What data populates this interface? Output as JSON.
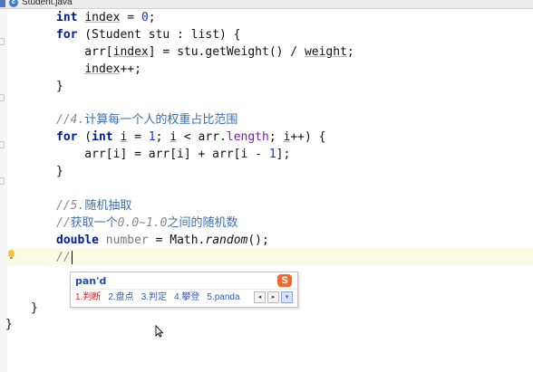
{
  "tab": {
    "label": "Student.java",
    "icon": "java-class-icon"
  },
  "code": [
    [
      {
        "t": "int",
        "c": "kw"
      },
      {
        "t": " "
      },
      {
        "t": "index",
        "c": "ul"
      },
      {
        "t": " = "
      },
      {
        "t": "0",
        "c": "num"
      },
      {
        "t": ";"
      }
    ],
    [
      {
        "t": "for",
        "c": "kw"
      },
      {
        "t": " (Student stu : list) {"
      }
    ],
    [
      {
        "t": "    arr["
      },
      {
        "t": "index",
        "c": "ul"
      },
      {
        "t": "] = stu.getWeight() / "
      },
      {
        "t": "weight",
        "c": "ul"
      },
      {
        "t": ";"
      }
    ],
    [
      {
        "t": "    "
      },
      {
        "t": "index",
        "c": "ul"
      },
      {
        "t": "++;"
      }
    ],
    [
      {
        "t": "}"
      }
    ],
    [],
    [
      {
        "t": "//4.",
        "c": "cm"
      },
      {
        "t": "计算每一个人的权重占比范围",
        "c": "cm cmj"
      }
    ],
    [
      {
        "t": "for",
        "c": "kw"
      },
      {
        "t": " ("
      },
      {
        "t": "int",
        "c": "kw"
      },
      {
        "t": " "
      },
      {
        "t": "i",
        "c": "ul"
      },
      {
        "t": " = "
      },
      {
        "t": "1",
        "c": "num"
      },
      {
        "t": "; "
      },
      {
        "t": "i",
        "c": "ul"
      },
      {
        "t": " < arr."
      },
      {
        "t": "length",
        "c": "fld"
      },
      {
        "t": "; "
      },
      {
        "t": "i",
        "c": "ul"
      },
      {
        "t": "++) {"
      }
    ],
    [
      {
        "t": "    arr[i] = arr[i] + arr[i - "
      },
      {
        "t": "1",
        "c": "num"
      },
      {
        "t": "];"
      }
    ],
    [
      {
        "t": "}"
      }
    ],
    [],
    [
      {
        "t": "//5.",
        "c": "cm"
      },
      {
        "t": "随机抽取",
        "c": "cm cmj"
      }
    ],
    [
      {
        "t": "//",
        "c": "cm"
      },
      {
        "t": "获取一个",
        "c": "cm cmj"
      },
      {
        "t": "0.0~1.0",
        "c": "cm"
      },
      {
        "t": "之间的随机数",
        "c": "cm cmj"
      }
    ],
    [
      {
        "t": "double",
        "c": "kw"
      },
      {
        "t": " "
      },
      {
        "t": "number",
        "c": "gray"
      },
      {
        "t": " = Math."
      },
      {
        "t": "random",
        "c": "stat"
      },
      {
        "t": "();"
      }
    ],
    [
      {
        "t": "//",
        "c": "cm"
      }
    ]
  ],
  "closing_braces": [
    "}",
    "}"
  ],
  "ime": {
    "composition": "pan'd",
    "logo": "S",
    "candidates": [
      {
        "label": "1.判断",
        "selected": true
      },
      {
        "label": "2.盘点",
        "selected": false
      },
      {
        "label": "3.判定",
        "selected": false
      },
      {
        "label": "4.攀登",
        "selected": false
      },
      {
        "label": "5.panda",
        "selected": false
      }
    ],
    "prev_page": "◂",
    "next_page": "▸",
    "dropdown": "▾"
  },
  "colors": {
    "keyword": "#001c96",
    "number": "#1a33d6",
    "comment": "#8a8a8a",
    "field": "#7d1fa6",
    "ime_accent": "#ef6a2a"
  }
}
